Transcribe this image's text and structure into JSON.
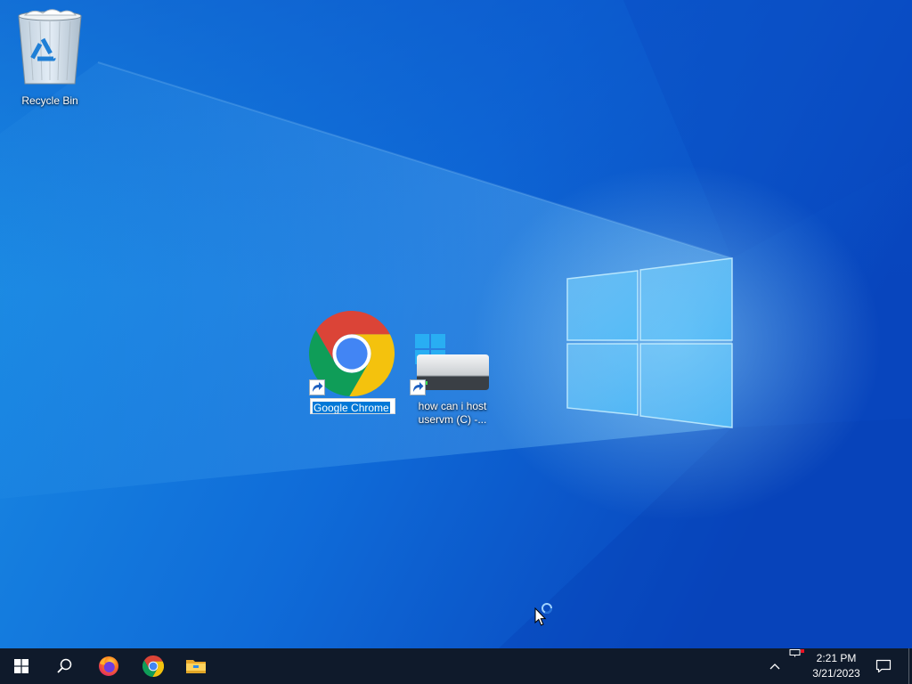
{
  "desktop": {
    "recycle_bin": {
      "label": "Recycle Bin",
      "icon": "recycle-bin-icon"
    },
    "chrome_shortcut": {
      "label": "Google Chrome",
      "icon": "chrome-icon",
      "label_selected": true
    },
    "drive_shortcut": {
      "label": "how can i host uservm (C) -...",
      "icon": "drive-icon"
    }
  },
  "taskbar": {
    "start": {
      "icon": "windows-icon"
    },
    "search": {
      "icon": "search-icon"
    },
    "pinned": [
      {
        "icon": "firefox-icon"
      },
      {
        "icon": "chrome-icon"
      },
      {
        "icon": "file-explorer-icon"
      }
    ],
    "tray": {
      "overflow_icon": "chevron-up-icon",
      "network_icon": "network-icon",
      "time": "2:21 PM",
      "date": "3/21/2023",
      "notifications_icon": "notification-icon"
    }
  },
  "colors": {
    "wallpaper": "#0f6bd8",
    "taskbar": "#0f1a2b",
    "selection": "#0078d7",
    "chrome_red": "#db4437",
    "chrome_yellow": "#f4c20d",
    "chrome_green": "#0f9d58",
    "chrome_blue": "#4285f4"
  }
}
